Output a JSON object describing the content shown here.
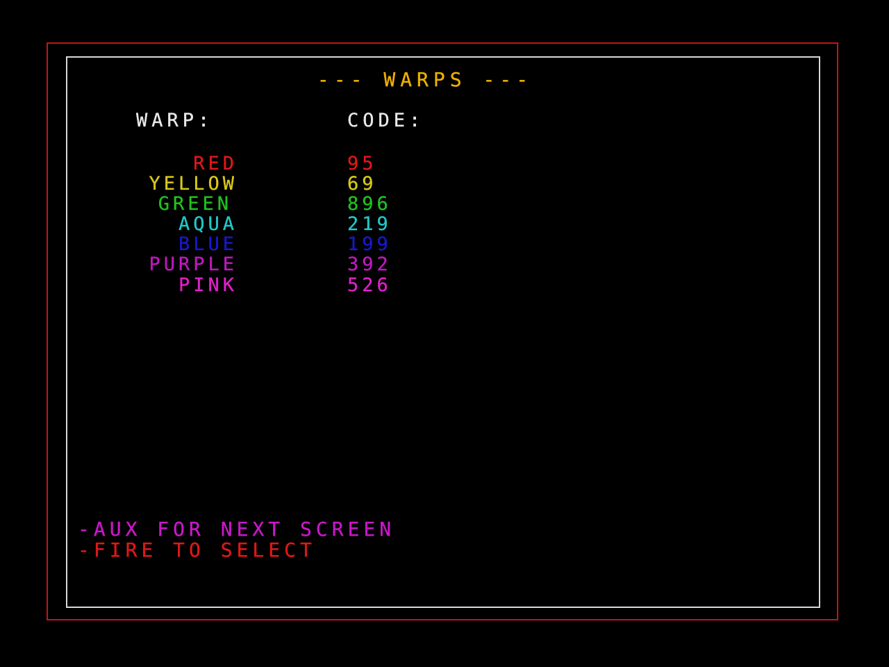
{
  "screen": {
    "title_dashes_left": "---",
    "title": "WARPS",
    "title_dashes_right": "---",
    "headers": {
      "warp": "WARP:",
      "code": "CODE:"
    },
    "warps": [
      {
        "name": "RED",
        "code": "95",
        "color": "#e01818"
      },
      {
        "name": "YELLOW",
        "code": "69",
        "color": "#d8c818"
      },
      {
        "name": "GREEN",
        "code": "896",
        "color": "#20c020"
      },
      {
        "name": "AQUA",
        "code": "219",
        "color": "#20c8c8"
      },
      {
        "name": "BLUE",
        "code": "199",
        "color": "#1818d0"
      },
      {
        "name": "PURPLE",
        "code": "392",
        "color": "#c018c0"
      },
      {
        "name": "PINK",
        "code": "526",
        "color": "#e020c8"
      }
    ],
    "instructions": [
      {
        "text": "-AUX FOR NEXT SCREEN",
        "color": "#c818c8"
      },
      {
        "text": "-FIRE TO SELECT",
        "color": "#e01818"
      }
    ],
    "colors": {
      "outer_border": "#c41616",
      "inner_border": "#d8d8d8",
      "title": "#f0b000",
      "header": "#e8e8e8",
      "background": "#000000"
    }
  }
}
